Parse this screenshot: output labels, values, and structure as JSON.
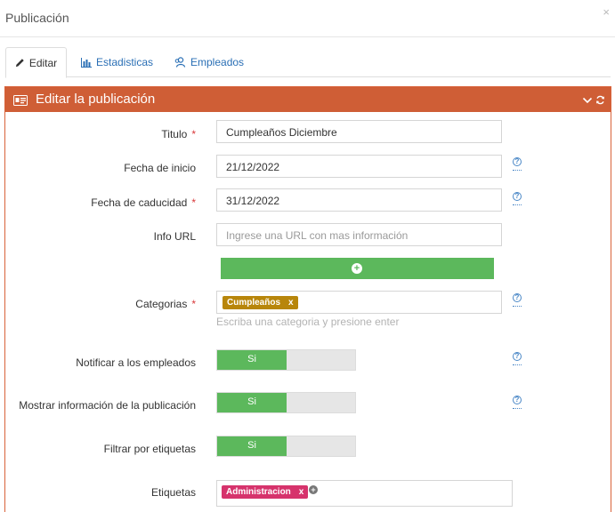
{
  "modal": {
    "title": "Publicación",
    "close_glyph": "×"
  },
  "tabs": [
    {
      "label": "Editar",
      "icon": "pencil-icon",
      "active": true
    },
    {
      "label": "Estadisticas",
      "icon": "bar-chart-icon",
      "active": false
    },
    {
      "label": "Empleados",
      "icon": "users-icon",
      "active": false
    }
  ],
  "panel": {
    "title": "Editar la publicación",
    "header_color": "#cf5e36"
  },
  "form": {
    "titulo": {
      "label": "Titulo",
      "value": "Cumpleaños Diciembre",
      "required": "*"
    },
    "fecha_inicio": {
      "label": "Fecha de inicio",
      "value": "21/12/2022"
    },
    "fecha_caducidad": {
      "label": "Fecha de caducidad",
      "value": "31/12/2022",
      "required": "*"
    },
    "info_url": {
      "label": "Info URL",
      "placeholder": "Ingrese una URL con mas información"
    },
    "categorias": {
      "label": "Categorias",
      "required": "*",
      "tags": [
        "Cumpleaños"
      ],
      "hint": "Escriba una categoria y presione enter"
    },
    "notificar": {
      "label": "Notificar a los empleados",
      "state": "Si"
    },
    "mostrar_info": {
      "label": "Mostrar información de la publicación",
      "state": "Si"
    },
    "filtrar": {
      "label": "Filtrar por etiquetas",
      "state": "Si"
    },
    "etiquetas": {
      "label": "Etiquetas",
      "tags": [
        "Administracion"
      ]
    },
    "tag_remove_glyph": "x",
    "help_glyph": "?"
  },
  "colors": {
    "accent": "#cf5e36",
    "success": "#5cb85c",
    "link": "#2a6fb5",
    "tag_category": "#b8860b",
    "tag_label": "#d6336c"
  }
}
